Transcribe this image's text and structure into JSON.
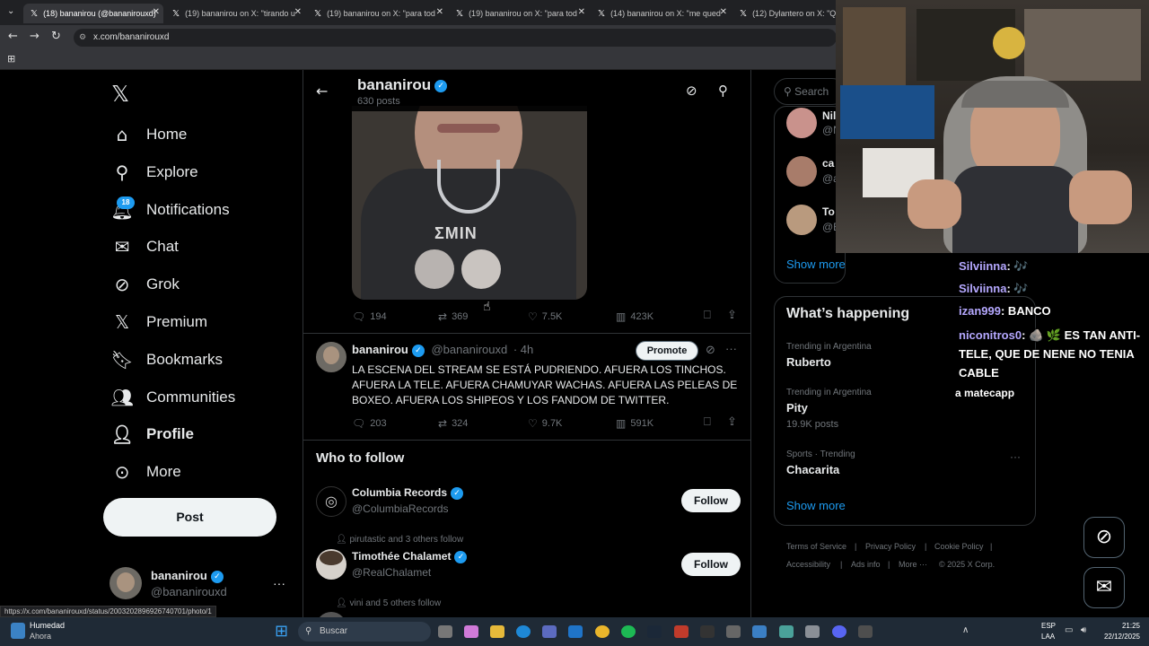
{
  "browser": {
    "tabs": [
      {
        "title": "(18) bananirou (@bananirouxd)"
      },
      {
        "title": "(19) bananirou on X: \"tirando u"
      },
      {
        "title": "(19) bananirou on X: \"para tod"
      },
      {
        "title": "(19) bananirou on X: \"para tod"
      },
      {
        "title": "(14) bananirou on X: \"me qued"
      },
      {
        "title": "(12) Dylantero on X: \"Que"
      }
    ],
    "url": "x.com/bananirouxd",
    "status_url": "https://x.com/bananirouxd/status/2003202896926740701/photo/1"
  },
  "sidebar": {
    "logo": "x-logo",
    "items": [
      {
        "label": "Home",
        "icon": "home-icon"
      },
      {
        "label": "Explore",
        "icon": "search-icon"
      },
      {
        "label": "Notifications",
        "icon": "bell-icon"
      },
      {
        "label": "Chat",
        "icon": "mail-icon"
      },
      {
        "label": "Grok",
        "icon": "grok-icon"
      },
      {
        "label": "Premium",
        "icon": "x-logo-icon"
      },
      {
        "label": "Bookmarks",
        "icon": "bookmark-icon"
      },
      {
        "label": "Communities",
        "icon": "people-icon"
      },
      {
        "label": "Profile",
        "icon": "person-icon"
      },
      {
        "label": "More",
        "icon": "more-circle-icon"
      }
    ],
    "notif_badge": "18",
    "post_label": "Post",
    "account": {
      "name": "bananirou",
      "handle": "@bananirouxd",
      "more": "···"
    }
  },
  "profile_header": {
    "name": "bananirou",
    "posts": "630 posts"
  },
  "tweet1": {
    "replies": "194",
    "retweets": "369",
    "likes": "7.5K",
    "views": "423K"
  },
  "tweet2": {
    "name": "bananirou",
    "handle": "@bananirouxd",
    "time": "· 4h",
    "promote": "Promote",
    "text": "LA ESCENA DEL STREAM SE ESTÁ PUDRIENDO. AFUERA LOS TINCHOS. AFUERA LA TELE. AFUERA CHAMUYAR WACHAS. AFUERA LAS PELEAS DE BOXEO. AFUERA LOS SHIPEOS Y LOS FANDOM DE TWITTER.",
    "replies": "203",
    "retweets": "324",
    "likes": "9.7K",
    "views": "591K"
  },
  "who_to_follow": {
    "title": "Who to follow",
    "follow_label": "Follow",
    "items": [
      {
        "context": "",
        "name": "Columbia Records",
        "handle": "@ColumbiaRecords"
      },
      {
        "context": "pirutastic and 3 others follow",
        "name": "Timothée Chalamet",
        "handle": "@RealChalamet"
      },
      {
        "context": "vini and 5 others follow",
        "name": "",
        "handle": ""
      }
    ]
  },
  "right": {
    "search_placeholder": "Search",
    "suggested": [
      {
        "name": "Nil",
        "handle": "@N"
      },
      {
        "name": "ca",
        "handle": "@a"
      },
      {
        "name": "To",
        "handle": "@E"
      }
    ],
    "show_more": "Show more",
    "happening_title": "What’s happening",
    "trends": [
      {
        "context": "Trending in Argentina",
        "name": "Ruberto",
        "count": ""
      },
      {
        "context": "Trending in Argentina",
        "name": "Pity",
        "count": "19.9K posts"
      },
      {
        "context": "Sports · Trending",
        "name": "Chacarita",
        "count": ""
      }
    ],
    "show_more_2": "Show more",
    "footer": [
      "Terms of Service",
      "|",
      "Privacy Policy",
      "|",
      "Cookie Policy",
      "|",
      "Accessibility",
      "|",
      "Ads info",
      "|",
      "More ···",
      "© 2025 X Corp."
    ]
  },
  "chat": [
    {
      "user": "Silviinna",
      "msg": ": 🎶"
    },
    {
      "user": "Silviinna",
      "msg": ": 🎶"
    },
    {
      "user": "izan999",
      "msg": ": BANCO"
    },
    {
      "user": "niconitros0",
      "msg": ": 🪨 🌿 ES TAN ANTI-TELE, QUE DE NENE NO TENIA CABLE"
    },
    {
      "user": "",
      "msg": "a matecapp"
    }
  ],
  "taskbar": {
    "weather": "Humedad",
    "weather_sub": "Ahora",
    "search": "Buscar",
    "lang": "ESP",
    "lang_sub": "LAA",
    "time": "21:25",
    "date": "22/12/2025"
  },
  "colors": {
    "accent": "#1d9bf0",
    "bg": "#000000",
    "border": "#2f3336",
    "muted": "#71767b"
  }
}
